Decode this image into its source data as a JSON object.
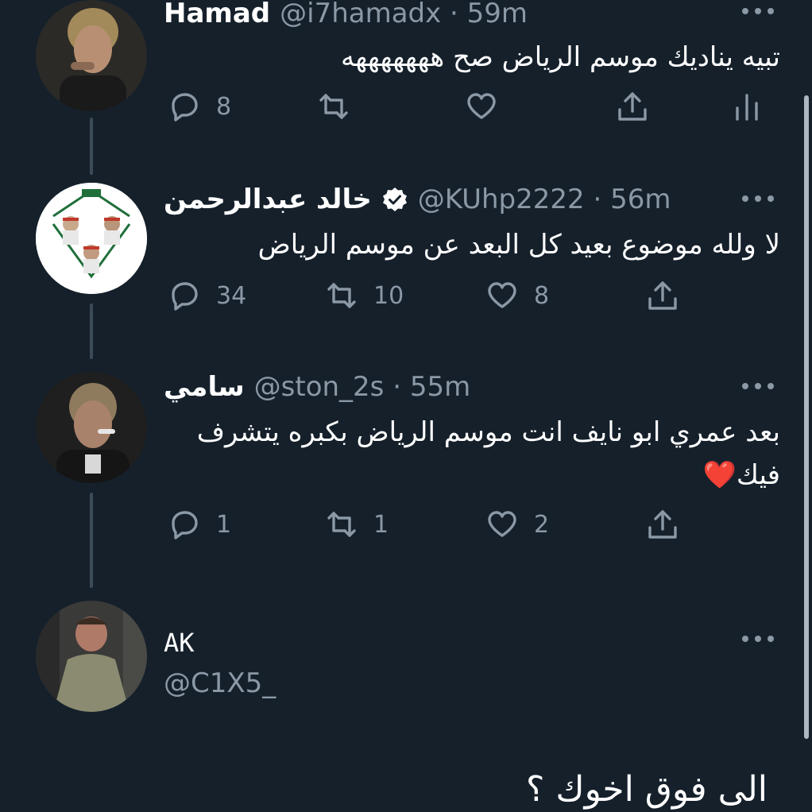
{
  "tweets": [
    {
      "name": "Hamad",
      "handle": "@i7hamadx · 59m",
      "text": "تبيه يناديك موسم الرياض صح هههههههه",
      "replies": "8",
      "retweets": "",
      "likes": ""
    },
    {
      "name": "خالد عبدالرحمن",
      "handle": "@KUhp2222 · 56m",
      "text": "لا ولله موضوع بعيد كل البعد عن موسم الرياض",
      "replies": "34",
      "retweets": "10",
      "likes": "8"
    },
    {
      "name": "سامي",
      "handle": "@ston_2s · 55m",
      "text_line1": "بعد عمري ابو نايف انت موسم الرياض بكبره يتشرف",
      "text_line2": "فيك❤️",
      "replies": "1",
      "retweets": "1",
      "likes": "2"
    }
  ],
  "reply_box": {
    "name": "AK",
    "handle": "@C1X5_"
  },
  "caption": "الى فوق اخوك ؟",
  "icons": [
    "reply-icon",
    "retweet-icon",
    "like-icon",
    "share-icon",
    "analytics-icon",
    "verified-icon",
    "more-icon"
  ],
  "colors": {
    "background": "#15202b",
    "secondary_text": "#8b98a5",
    "thread_line": "#3d4a57"
  }
}
